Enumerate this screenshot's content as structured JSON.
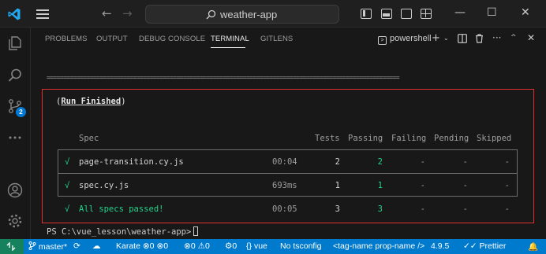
{
  "titlebar": {
    "search_text": "weather-app",
    "minimize": "—",
    "maximize": "☐",
    "close": "✕"
  },
  "activitybar": {
    "source_control_badge": "2"
  },
  "panel": {
    "tabs": [
      {
        "label": "PROBLEMS"
      },
      {
        "label": "OUTPUT"
      },
      {
        "label": "DEBUG CONSOLE"
      },
      {
        "label": "TERMINAL",
        "active": true
      },
      {
        "label": "GITLENS"
      }
    ],
    "terminal_shell": "powershell"
  },
  "terminal": {
    "rule": "==========================================================================================================",
    "run_finished": "Run Finished",
    "open_paren": "(",
    "close_paren": ")",
    "headers": {
      "spec": "Spec",
      "tests": "Tests",
      "passing": "Passing",
      "failing": "Failing",
      "pending": "Pending",
      "skipped": "Skipped"
    },
    "rows": [
      {
        "check": "√",
        "spec": "page-transition.cy.js",
        "time": "00:04",
        "tests": "2",
        "passing": "2",
        "failing": "-",
        "pending": "-",
        "skipped": "-"
      },
      {
        "check": "√",
        "spec": "spec.cy.js",
        "time": "693ms",
        "tests": "1",
        "passing": "1",
        "failing": "-",
        "pending": "-",
        "skipped": "-"
      }
    ],
    "summary": {
      "check": "√",
      "label": "All specs passed!",
      "time": "00:05",
      "tests": "3",
      "passing": "3",
      "failing": "-",
      "pending": "-",
      "skipped": "-"
    },
    "prompt": "PS C:\\vue_lesson\\weather-app>"
  },
  "statusbar": {
    "branch": "master*",
    "karma": "Karate",
    "errors_a": "0",
    "warnings_a": "0",
    "errors_b": "0",
    "warnings_b": "0",
    "problems_c": "0",
    "vue": "vue",
    "tsconfig": "No tsconfig",
    "tag_name": "<tag-name prop-name />",
    "ts_version": "4.9.5",
    "prettier": "Prettier"
  },
  "colors": {
    "accent": "#007acc",
    "success": "#23d18b",
    "highlight_border": "#e0302e"
  }
}
